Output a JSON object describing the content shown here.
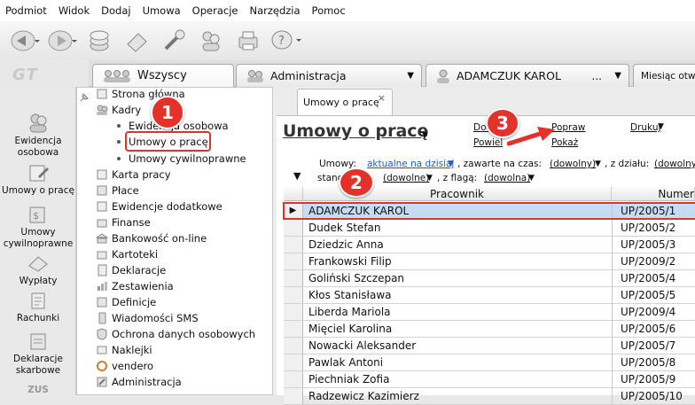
{
  "menu": [
    "Podmiot",
    "Widok",
    "Dodaj",
    "Umowa",
    "Operacje",
    "Narzędzia",
    "Pomoc"
  ],
  "topTabs": [
    {
      "label": "Wszyscy"
    },
    {
      "label": "Administracja"
    },
    {
      "label": "ADAMCZUK KAROL",
      "extra": "..."
    },
    {
      "label": "Miesiąc otwa"
    }
  ],
  "sidebar": [
    {
      "label": "Ewidencja osobowa",
      "icon": "people-icon"
    },
    {
      "label": "Umowy o pracę",
      "icon": "contract-icon"
    },
    {
      "label": "Umowy cywilnoprawne",
      "icon": "civil-contract-icon"
    },
    {
      "label": "Wypłaty",
      "icon": "payout-icon"
    },
    {
      "label": "Rachunki",
      "icon": "bill-icon"
    },
    {
      "label": "Deklaracje skarbowe",
      "icon": "tax-declaration-icon"
    }
  ],
  "tree": {
    "home": "Strona główna",
    "kadry": "Kadry",
    "sub1": "Ewidencja osobowa",
    "sub2": "Umowy o pracę",
    "sub3": "Umowy cywilnoprawne",
    "items": [
      "Karta pracy",
      "Płace",
      "Ewidencje dodatkowe",
      "Finanse",
      "Bankowość on-line",
      "Kartoteki",
      "Deklaracje",
      "Zestawienia",
      "Definicje",
      "Wiadomości SMS",
      "Ochrona danych osobowych",
      "Naklejki",
      "vendero",
      "Administracja"
    ]
  },
  "docTab": {
    "label": "Umowy o pracę",
    "close": "×"
  },
  "page": {
    "title": "Umowy o pracę",
    "actions": {
      "add": "Dodaj",
      "edit": "Popraw",
      "print": "Drukuj",
      "bind": "Powiel",
      "show": "Pokaż"
    },
    "filters": {
      "contractsLabel": "Umowy:",
      "contractsValue": "aktualne na dzisiaj",
      "timeLabel": ", zawarte na czas:",
      "timeValue": "(dowolny)",
      "deptLabel": ", z działu:",
      "deptValue": "(dowolny)",
      "posLabel": "stanowisko:",
      "posValue": "(dowolne)",
      "flagLabel": ", z flagą:",
      "flagValue": "(dowolna)"
    }
  },
  "grid": {
    "headers": [
      "Pracownik",
      "Numer"
    ],
    "rows": [
      [
        "ADAMCZUK KAROL",
        "UP/2005/1"
      ],
      [
        "Dudek Stefan",
        "UP/2005/2"
      ],
      [
        "Dziedzic Anna",
        "UP/2005/3"
      ],
      [
        "Frankowski Filip",
        "UP/2009/2"
      ],
      [
        "Goliński Szczepan",
        "UP/2005/4"
      ],
      [
        "Kłos Stanisława",
        "UP/2005/5"
      ],
      [
        "Liberda Mariola",
        "UP/2009/4"
      ],
      [
        "Mięciel Karolina",
        "UP/2005/6"
      ],
      [
        "Nowacki Aleksander",
        "UP/2005/7"
      ],
      [
        "Pawlak Antoni",
        "UP/2005/8"
      ],
      [
        "Piechniak Zofia",
        "UP/2005/9"
      ],
      [
        "Radzewicz Kazimierz",
        "UP/2005/10"
      ]
    ]
  },
  "callouts": [
    "1",
    "2",
    "3"
  ],
  "colors": {
    "accent": "#e2322a",
    "selection": "#c6dcf4",
    "link": "#1a5fb4"
  }
}
